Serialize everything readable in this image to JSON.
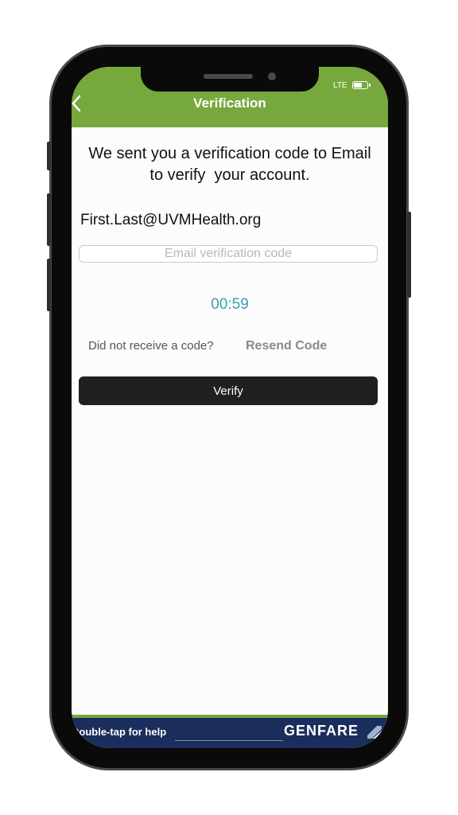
{
  "header": {
    "title": "Verification"
  },
  "status_bar": {
    "network": "LTE",
    "battery_level": 0.6
  },
  "main": {
    "message": "We sent you a verification code to Email\nto verify  your account.",
    "email": "First.Last@UVMHealth.org",
    "code_input": {
      "placeholder": "Email verification code",
      "value": ""
    },
    "timer": "00:59",
    "no_code_text": "Did not receive a code?",
    "resend_label": "Resend Code",
    "verify_label": "Verify"
  },
  "help_bar": {
    "text": "Double-tap for help",
    "brand": "GENFARE"
  },
  "colors": {
    "header": "#76a83e",
    "timer": "#3a9fb5",
    "help_bar": "#1b2d5c",
    "button": "#202020"
  }
}
